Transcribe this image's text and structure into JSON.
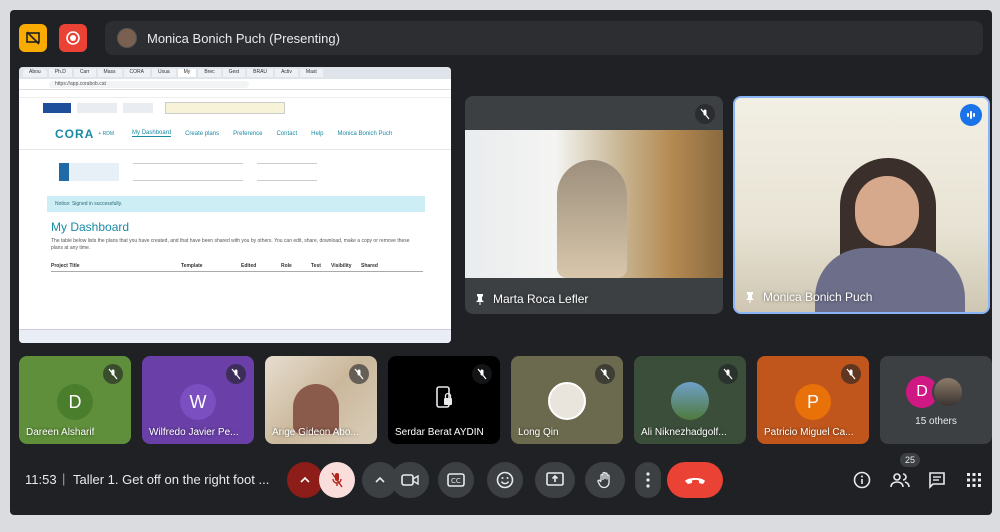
{
  "topbar": {
    "presenter_name": "Monica Bonich Puch (Presenting)"
  },
  "shared_screen": {
    "tabs": [
      "Abou",
      "Ph.D",
      "Carr",
      "Mass",
      "CORA",
      "Usua",
      "My",
      "Brec",
      "Gest",
      "BRAU",
      "Activ",
      "Mast"
    ],
    "url": "https://app.corabob.cat",
    "site_nav": [
      "My Dashboard",
      "Create plans",
      "Preference",
      "Contact",
      "Help",
      "Monica Bonich Puch"
    ],
    "logo": "CORA",
    "logo_sub": "+ RDM",
    "notice": "Notice: Signed in successfully.",
    "heading": "My Dashboard",
    "description": "The table below lists the plans that you have created, and that have been shared with you by others. You can edit, share, download, make a copy or remove these plans at any time.",
    "columns": [
      "Project Title",
      "Template",
      "Edited",
      "Role",
      "Test",
      "Visibility",
      "Shared"
    ]
  },
  "participants": [
    {
      "name": "Marta Roca Lefler"
    },
    {
      "name": "Monica Bonich Puch"
    },
    {
      "name": "Dareen Alsharif",
      "initial": "D",
      "color": "#5f8f3a",
      "avatar_color": "#4a7d2c"
    },
    {
      "name": "Wilfredo Javier Pe...",
      "initial": "W",
      "color": "#6a3fa8",
      "avatar_color": "#7b4fc0"
    },
    {
      "name": "Arige Gideon Abo..."
    },
    {
      "name": "Serdar Berat AYDIN"
    },
    {
      "name": "Long Qin"
    },
    {
      "name": "Ali Niknezhadgolf..."
    },
    {
      "name": "Patricio Miguel Ca...",
      "initial": "P",
      "color": "#c0561c",
      "avatar_color": "#e8710a"
    }
  ],
  "others": {
    "initial": "D",
    "label": "15 others"
  },
  "meeting": {
    "time": "11:53",
    "separator": "|",
    "title": "Taller 1. Get off on the right foot ...",
    "participant_count": "25"
  },
  "colors": {
    "end_call": "#ea4335",
    "mic_off_bg": "#f9dedc",
    "active_speaker": "#8ab4f8"
  }
}
